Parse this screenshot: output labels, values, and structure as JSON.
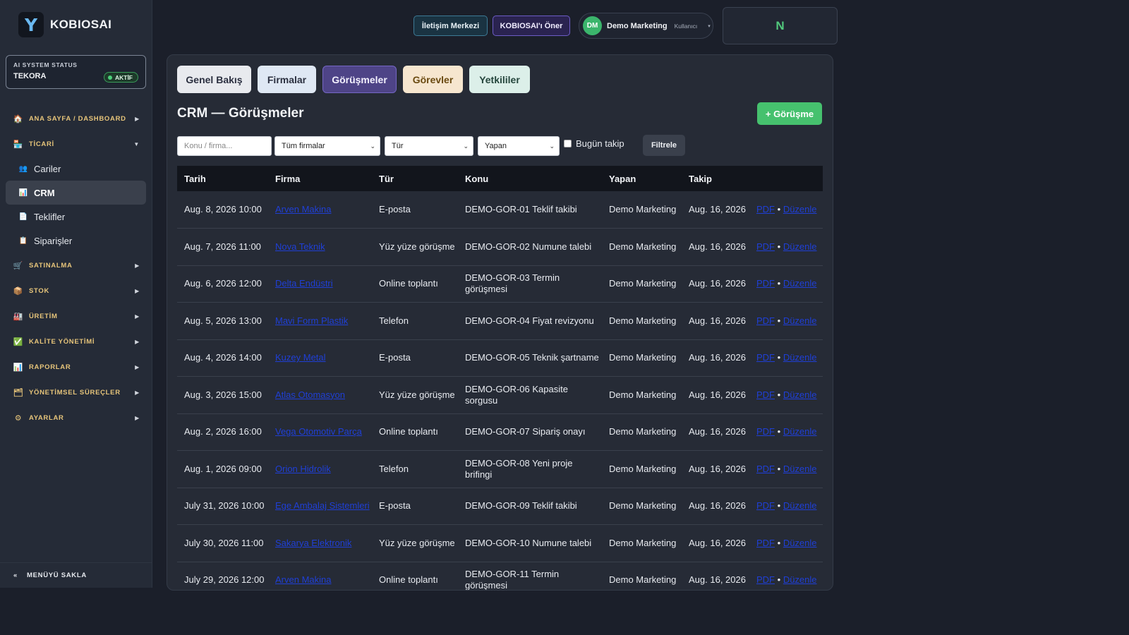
{
  "brand": {
    "logo": "Y",
    "name": "KOBIOSAI"
  },
  "status": {
    "title": "AI SYSTEM STATUS",
    "name": "TEKORA",
    "badge": "AKTİF"
  },
  "sidebar": {
    "sections": [
      {
        "icon": "home-icon",
        "glyph": "🏠",
        "label": "ANA SAYFA / DASHBOARD",
        "arrow": "▶"
      },
      {
        "icon": "store-icon",
        "glyph": "🏪",
        "label": "TİCARİ",
        "arrow": "▼"
      }
    ],
    "sub": [
      {
        "icon": "users-icon",
        "glyph": "👥",
        "label": "Cariler"
      },
      {
        "icon": "chart-icon",
        "glyph": "📊",
        "label": "CRM"
      },
      {
        "icon": "document-icon",
        "glyph": "📄",
        "label": "Teklifler"
      },
      {
        "icon": "clipboard-icon",
        "glyph": "📋",
        "label": "Siparişler"
      }
    ],
    "sections2": [
      {
        "icon": "cart-icon",
        "glyph": "🛒",
        "label": "SATINALMA",
        "arrow": "▶"
      },
      {
        "icon": "box-icon",
        "glyph": "📦",
        "label": "STOK",
        "arrow": "▶"
      },
      {
        "icon": "factory-icon",
        "glyph": "🏭",
        "label": "ÜRETİM",
        "arrow": "▶"
      },
      {
        "icon": "check-icon",
        "glyph": "✅",
        "label": "KALİTE YÖNETİMİ",
        "arrow": "▶"
      },
      {
        "icon": "report-icon",
        "glyph": "📊",
        "label": "RAPORLAR",
        "arrow": "▶"
      },
      {
        "icon": "folder-icon",
        "glyph": "🗂",
        "label": "YÖNETİMSEL SÜREÇLER",
        "arrow": "▶"
      },
      {
        "icon": "gear-icon",
        "glyph": "⚙",
        "label": "AYARLAR",
        "arrow": "▶"
      }
    ],
    "hide_menu": {
      "glyph": "«",
      "label": "MENÜYÜ SAKLA"
    }
  },
  "header": {
    "contact": "İletişim Merkezi",
    "recommend": "KOBIOSAI'ı Öner",
    "user": {
      "initials": "DM",
      "name": "Demo Marketing",
      "role": "Kullanıcı",
      "caret": "▾"
    },
    "box": "N"
  },
  "tabs": [
    "Genel Bakış",
    "Firmalar",
    "Görüşmeler",
    "Görevler",
    "Yetkililer"
  ],
  "page_title": "CRM — Görüşmeler",
  "add_button": "+ Görüşme",
  "filters": {
    "search_placeholder": "Konu / firma...",
    "firm": "Tüm firmalar",
    "type": "Tür",
    "by": "Yapan",
    "today": "Bugün takip",
    "submit": "Filtrele"
  },
  "table": {
    "columns": [
      "Tarih",
      "Firma",
      "Tür",
      "Konu",
      "Yapan",
      "Takip",
      ""
    ],
    "pdf_label": "PDF",
    "edit_label": "Düzenle",
    "sep": "•",
    "rows": [
      {
        "date": "Aug. 8, 2026 10:00",
        "firm": "Arven Makina",
        "type": "E-posta",
        "subject": "DEMO-GOR-01 Teklif takibi",
        "by": "Demo Marketing",
        "follow": "Aug. 16, 2026"
      },
      {
        "date": "Aug. 7, 2026 11:00",
        "firm": "Nova Teknik",
        "type": "Yüz yüze görüşme",
        "subject": "DEMO-GOR-02 Numune talebi",
        "by": "Demo Marketing",
        "follow": "Aug. 16, 2026"
      },
      {
        "date": "Aug. 6, 2026 12:00",
        "firm": "Delta Endüstri",
        "type": "Online toplantı",
        "subject": "DEMO-GOR-03 Termin görüşmesi",
        "by": "Demo Marketing",
        "follow": "Aug. 16, 2026"
      },
      {
        "date": "Aug. 5, 2026 13:00",
        "firm": "Mavi Form Plastik",
        "type": "Telefon",
        "subject": "DEMO-GOR-04 Fiyat revizyonu",
        "by": "Demo Marketing",
        "follow": "Aug. 16, 2026"
      },
      {
        "date": "Aug. 4, 2026 14:00",
        "firm": "Kuzey Metal",
        "type": "E-posta",
        "subject": "DEMO-GOR-05 Teknik şartname",
        "by": "Demo Marketing",
        "follow": "Aug. 16, 2026"
      },
      {
        "date": "Aug. 3, 2026 15:00",
        "firm": "Atlas Otomasyon",
        "type": "Yüz yüze görüşme",
        "subject": "DEMO-GOR-06 Kapasite sorgusu",
        "by": "Demo Marketing",
        "follow": "Aug. 16, 2026"
      },
      {
        "date": "Aug. 2, 2026 16:00",
        "firm": "Vega Otomotiv Parça",
        "type": "Online toplantı",
        "subject": "DEMO-GOR-07 Sipariş onayı",
        "by": "Demo Marketing",
        "follow": "Aug. 16, 2026"
      },
      {
        "date": "Aug. 1, 2026 09:00",
        "firm": "Orion Hidrolik",
        "type": "Telefon",
        "subject": "DEMO-GOR-08 Yeni proje brifingi",
        "by": "Demo Marketing",
        "follow": "Aug. 16, 2026"
      },
      {
        "date": "July 31, 2026 10:00",
        "firm": "Ege Ambalaj Sistemleri",
        "type": "E-posta",
        "subject": "DEMO-GOR-09 Teklif takibi",
        "by": "Demo Marketing",
        "follow": "Aug. 16, 2026"
      },
      {
        "date": "July 30, 2026 11:00",
        "firm": "Sakarya Elektronik",
        "type": "Yüz yüze görüşme",
        "subject": "DEMO-GOR-10 Numune talebi",
        "by": "Demo Marketing",
        "follow": "Aug. 16, 2026"
      },
      {
        "date": "July 29, 2026 12:00",
        "firm": "Arven Makina",
        "type": "Online toplantı",
        "subject": "DEMO-GOR-11 Termin görüşmesi",
        "by": "Demo Marketing",
        "follow": "Aug. 16, 2026"
      }
    ]
  }
}
